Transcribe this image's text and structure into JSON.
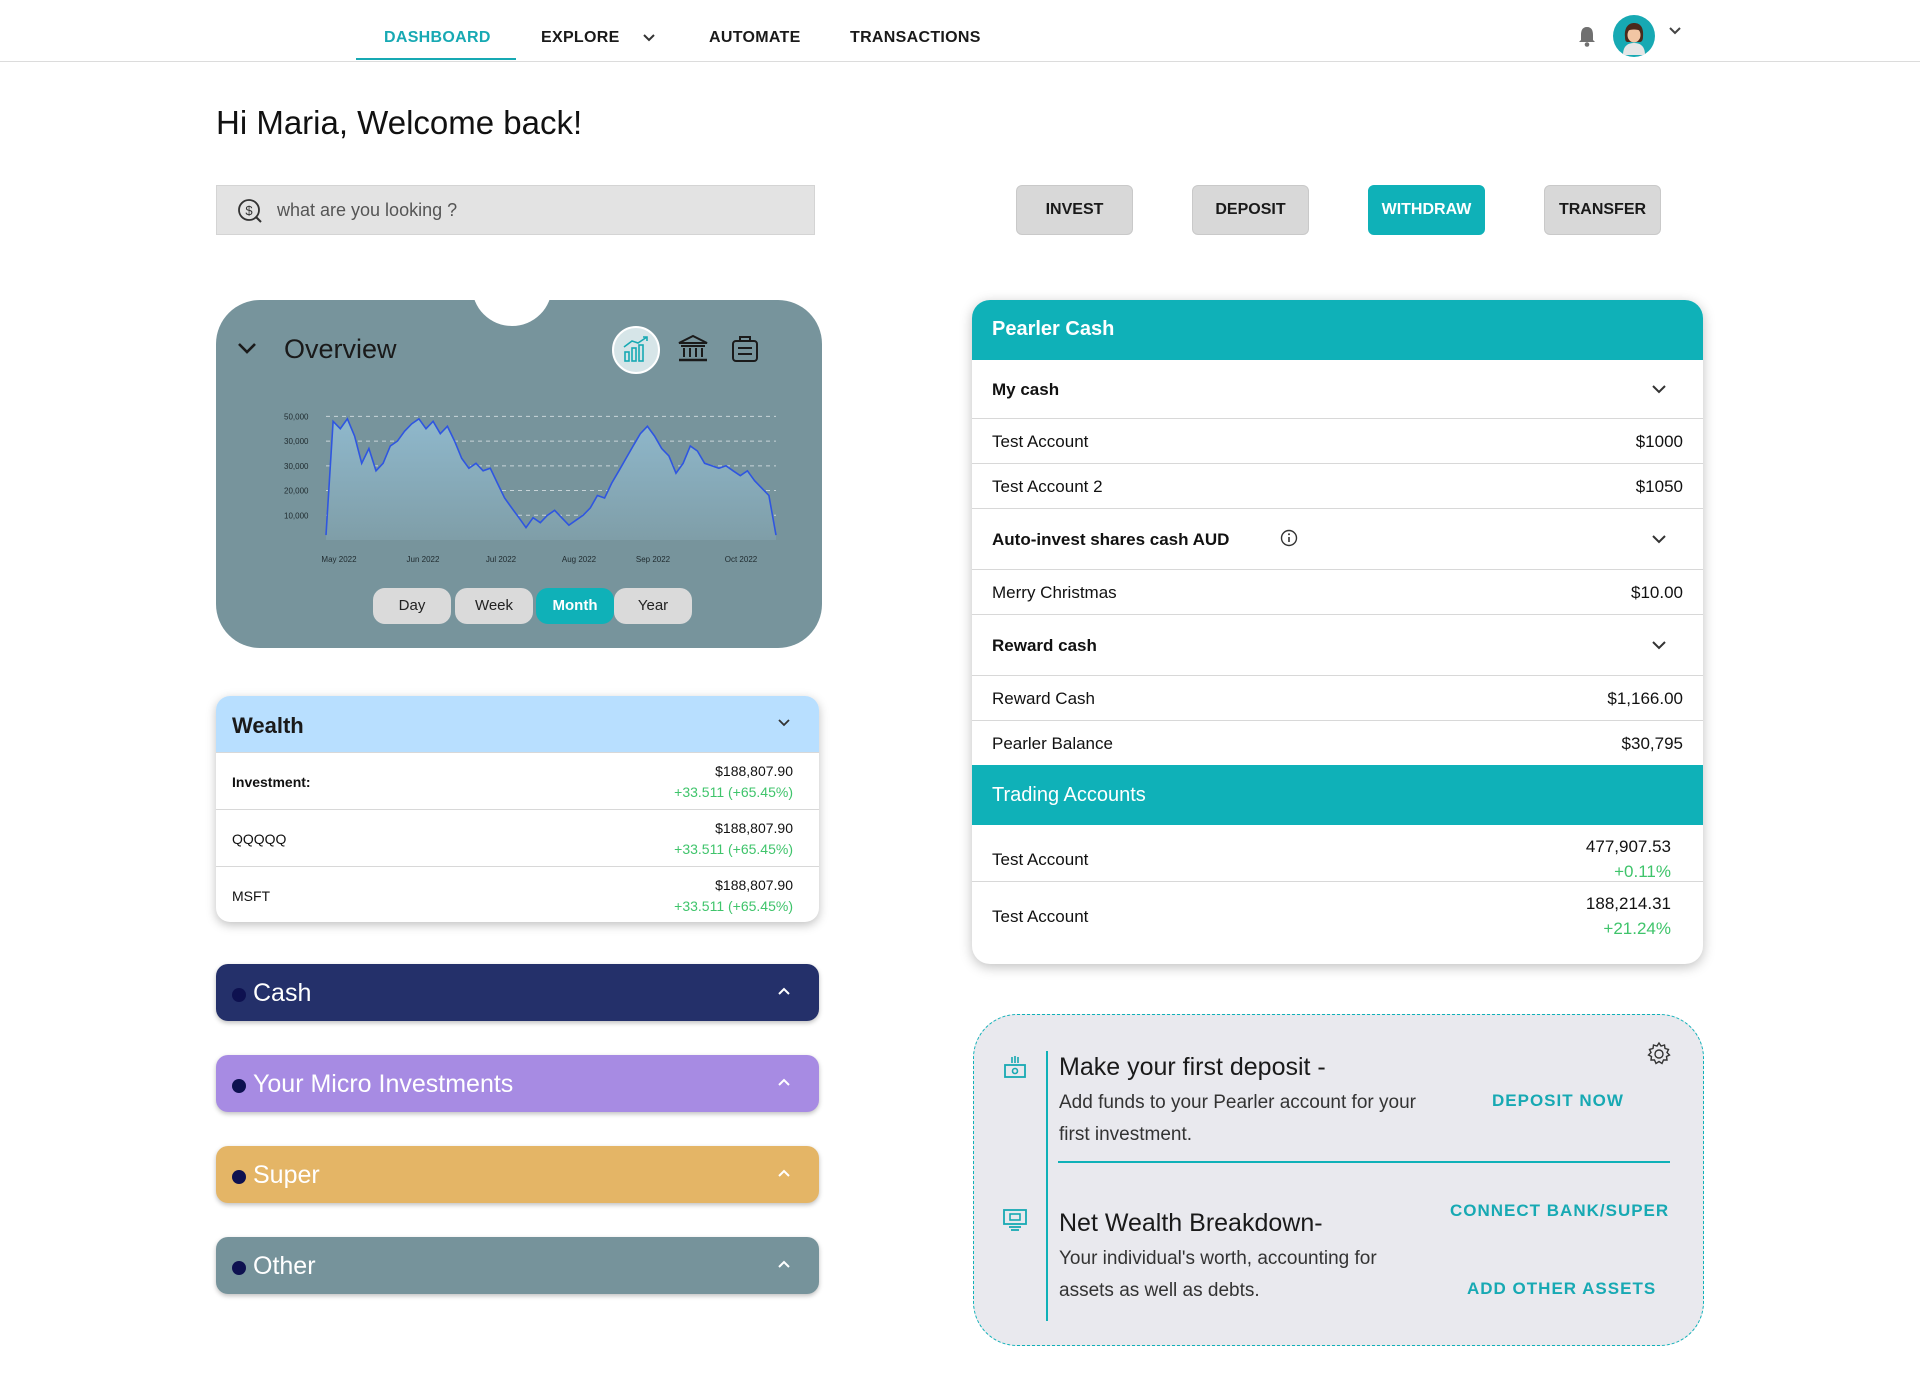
{
  "nav": {
    "items": [
      {
        "label": "DASHBOARD"
      },
      {
        "label": "EXPLORE"
      },
      {
        "label": "AUTOMATE"
      },
      {
        "label": "TRANSACTIONS"
      }
    ]
  },
  "welcome": "Hi Maria, Welcome back!",
  "search": {
    "placeholder": "what are you looking ?"
  },
  "actions": {
    "invest": "INVEST",
    "deposit": "DEPOSIT",
    "withdraw": "WITHDRAW",
    "transfer": "TRANSFER"
  },
  "overview": {
    "title": "Overview",
    "periods": [
      "Day",
      "Week",
      "Month",
      "Year"
    ],
    "active_period": "Month"
  },
  "chart_data": {
    "type": "area",
    "title": "",
    "xlabel": "",
    "ylabel": "",
    "y_tick_labels": [
      "50,000",
      "30,000",
      "30,000",
      "20,000",
      "10,000"
    ],
    "x_tick_labels": [
      "May 2022",
      "Jun 2022",
      "Jul 2022",
      "Aug 2022",
      "Sep 2022",
      "Oct 2022"
    ],
    "ylim": [
      0,
      55000
    ],
    "grid": true,
    "series": [
      {
        "values": [
          2000,
          48000,
          45000,
          49000,
          42000,
          31000,
          37000,
          28000,
          31000,
          38000,
          40000,
          44000,
          47000,
          49000,
          45000,
          48000,
          43000,
          46000,
          40000,
          33000,
          29000,
          31000,
          28000,
          29000,
          23000,
          17000,
          13000,
          9000,
          5000,
          9000,
          7000,
          10000,
          12000,
          9000,
          6000,
          8000,
          10000,
          13000,
          18000,
          17000,
          23000,
          28000,
          33000,
          38000,
          43000,
          46000,
          42000,
          37000,
          34000,
          27000,
          31000,
          38000,
          36000,
          31000,
          30000,
          29000,
          30000,
          28000,
          26000,
          28000,
          24000,
          21000,
          18000,
          2000
        ]
      }
    ]
  },
  "wealth": {
    "title": "Wealth",
    "rows": [
      {
        "label": "Investment:",
        "amount": "$188,807.90",
        "change": "+33.511 (+65.45%)"
      },
      {
        "label": "QQQQQ",
        "amount": "$188,807.90",
        "change": "+33.511 (+65.45%)"
      },
      {
        "label": "MSFT",
        "amount": "$188,807.90",
        "change": "+33.511 (+65.45%)"
      }
    ]
  },
  "categories": [
    {
      "label": "Cash",
      "color": "#24306a"
    },
    {
      "label": "Your Micro Investments",
      "color": "#a78be3"
    },
    {
      "label": "Super",
      "color": "#e4b566"
    },
    {
      "label": "Other",
      "color": "#76939b"
    }
  ],
  "pearler": {
    "title": "Pearler Cash",
    "my_cash": "My cash",
    "acc1_label": "Test Account",
    "acc1_value": "$1000",
    "acc2_label": "Test Account 2",
    "acc2_value": "$1050",
    "auto_invest": "Auto-invest shares cash AUD",
    "merry_label": "Merry Christmas",
    "merry_value": "$10.00",
    "reward_head": "Reward cash",
    "reward_label": "Reward Cash",
    "reward_value": "$1,166.00",
    "balance_label": "Pearler Balance",
    "balance_value": "$30,795",
    "trading_title": "Trading Accounts",
    "trading": [
      {
        "label": "Test Account",
        "value": "477,907.53",
        "change": "+0.11%"
      },
      {
        "label": "Test Account",
        "value": "188,214.31",
        "change": "+21.24%"
      }
    ]
  },
  "panel": {
    "deposit_title": "Make your first deposit -",
    "deposit_desc": "Add funds to your Pearler account for your first investment.",
    "deposit_link": "DEPOSIT NOW",
    "wealth_title": "Net Wealth Breakdown-",
    "wealth_desc": "Your individual's  worth, accounting for assets as well as debts.",
    "connect_link": "CONNECT BANK/SUPER",
    "assets_link": "ADD OTHER ASSETS"
  },
  "colors": {
    "accent": "#0fb1b8",
    "positive": "#3fc46b"
  }
}
